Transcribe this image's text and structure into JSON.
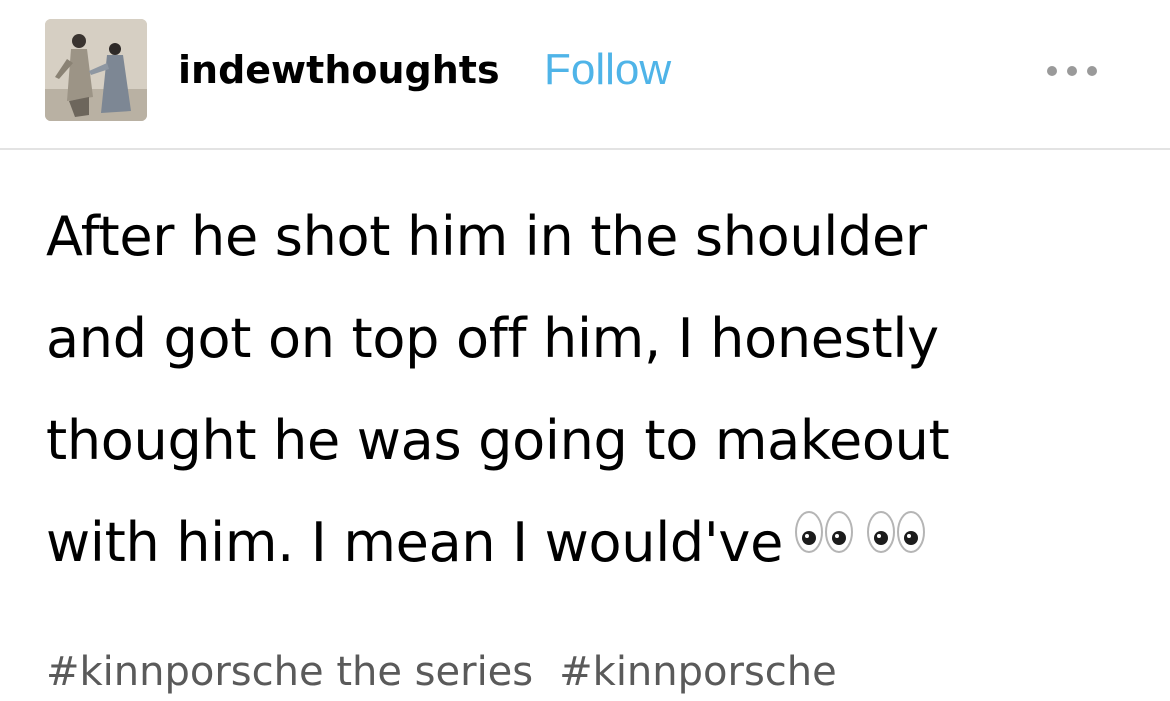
{
  "post": {
    "author": {
      "username": "indewthoughts",
      "follow_label": "Follow",
      "avatar_icon": "avatar-image"
    },
    "menu_icon": "more-options-icon",
    "body_lines": [
      "After he shot him in the shoulder",
      "and got on top off him, I honestly",
      "thought he was going to makeout",
      "with him. I mean I would've"
    ],
    "body_emoji": "eyes-emoji",
    "tags": [
      "#kinnporsche the series",
      "#kinnporsche"
    ]
  },
  "colors": {
    "follow": "#4fb4e8",
    "text": "#000000",
    "tags": "#5a5a5a",
    "divider": "#e3e3e3"
  }
}
